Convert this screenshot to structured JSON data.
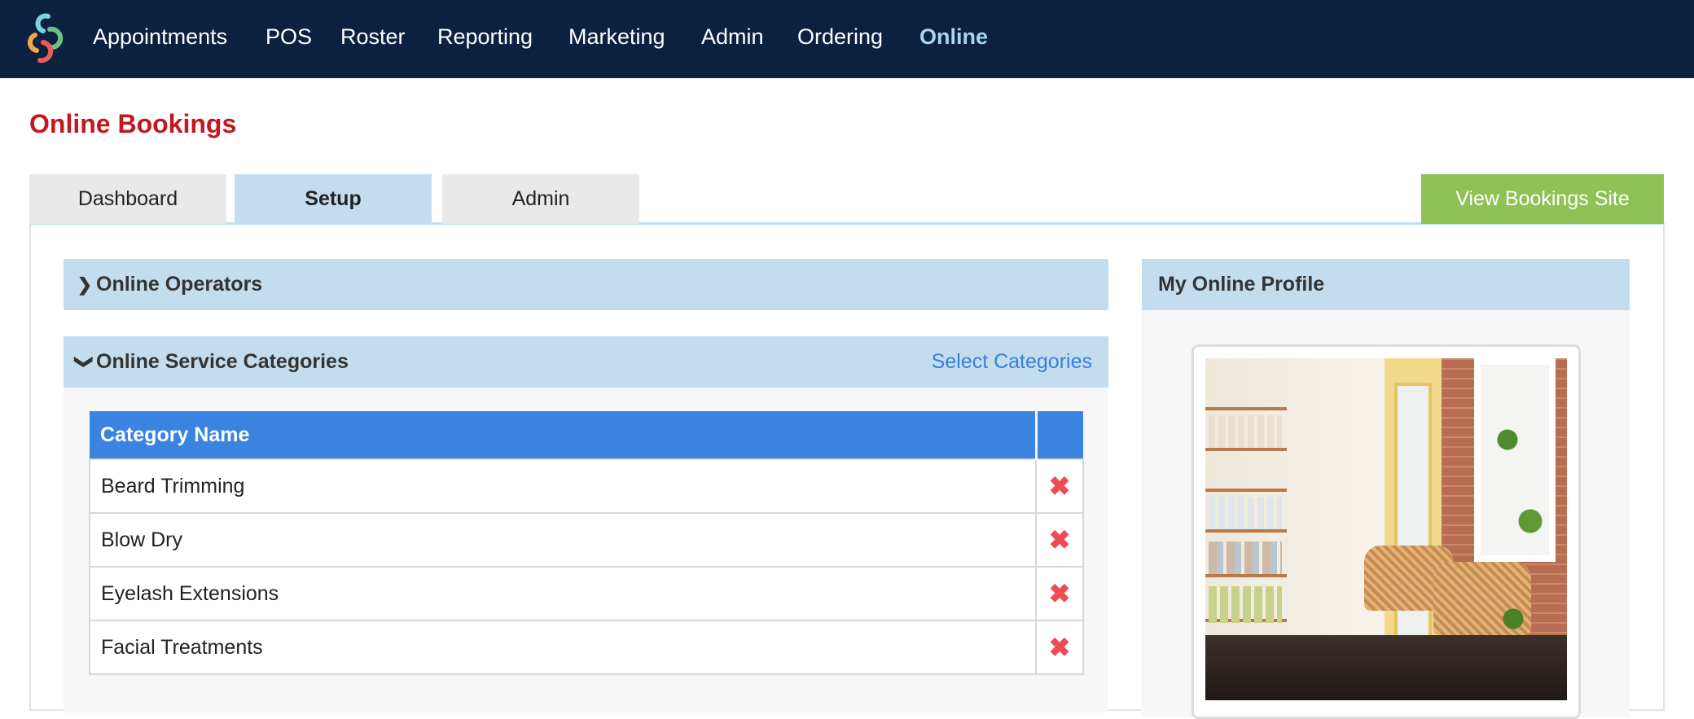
{
  "nav": {
    "logo": "brand-logo",
    "items": [
      "Appointments",
      "POS",
      "Roster",
      "Reporting",
      "Marketing",
      "Admin",
      "Ordering",
      "Online"
    ],
    "active": "Online"
  },
  "page": {
    "title": "Online Bookings"
  },
  "tabs": [
    {
      "label": "Dashboard"
    },
    {
      "label": "Setup",
      "active": true
    },
    {
      "label": "Admin"
    }
  ],
  "view_site_button": "View Bookings Site",
  "sections": {
    "operators": {
      "title": "Online Operators",
      "icon": "chevron-right-icon"
    },
    "categories": {
      "title": "Online Service Categories",
      "icon": "chevron-down-icon",
      "action": "Select Categories",
      "table": {
        "headers": [
          "Category Name",
          ""
        ],
        "rows": [
          "Beard Trimming",
          "Blow Dry",
          "Eyelash Extensions",
          "Facial Treatments"
        ],
        "delete_icon": "✖"
      }
    },
    "profile": {
      "title": "My Online Profile"
    }
  },
  "colors": {
    "nav_bg": "#0c2140",
    "title": "#c3161f",
    "section_bg": "#c3ddef",
    "table_header": "#3a83e0",
    "view_btn": "#8fc156",
    "link": "#3b7dd8",
    "delete": "#ef4b55"
  }
}
